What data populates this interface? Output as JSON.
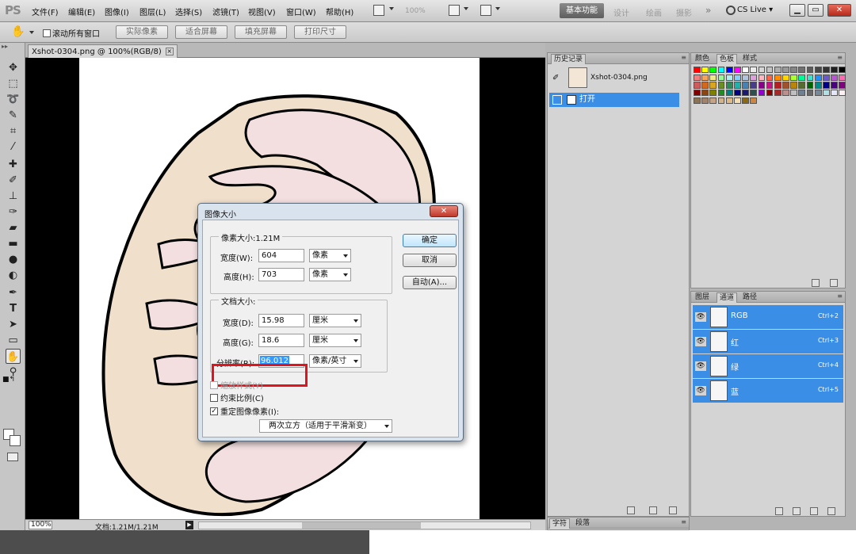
{
  "app": {
    "logo": "PS"
  },
  "menu": [
    "文件(F)",
    "编辑(E)",
    "图像(I)",
    "图层(L)",
    "选择(S)",
    "滤镜(T)",
    "视图(V)",
    "窗口(W)",
    "帮助(H)"
  ],
  "zoom_dropdown": "100%",
  "workspaces": {
    "active": "基本功能",
    "items": [
      "设计",
      "绘画",
      "摄影"
    ],
    "more": "»"
  },
  "cs_live": "CS Live ▾",
  "window_controls": {
    "minimize": "▁",
    "restore": "▭",
    "close": "✕"
  },
  "options_bar": {
    "scroll_all_windows": "滚动所有窗口",
    "buttons": [
      "实际像素",
      "适合屏幕",
      "填充屏幕",
      "打印尺寸"
    ]
  },
  "tools": [
    "move",
    "marquee",
    "lasso",
    "quick-select",
    "crop",
    "eyedropper",
    "healing",
    "brush",
    "stamp",
    "history-brush",
    "eraser",
    "gradient",
    "blur",
    "dodge",
    "pen",
    "type",
    "path-select",
    "shape",
    "hand",
    "zoom"
  ],
  "document": {
    "tab_title": "Xshot-0304.png @ 100%(RGB/8)",
    "tab_close": "×",
    "status_zoom": "100%",
    "status_doc": "文档:1.21M/1.21M",
    "status_arrow": "▶"
  },
  "history_panel": {
    "tabs": [
      "历史记录"
    ],
    "snapshot": "Xshot-0304.png",
    "states": [
      "打开"
    ]
  },
  "swatches_panel": {
    "tabs": [
      "颜色",
      "色板",
      "样式"
    ],
    "colors": [
      "#ff0000",
      "#ffff00",
      "#00ff00",
      "#00ffff",
      "#0000ff",
      "#ff00ff",
      "#ffffff",
      "#ebebeb",
      "#d6d6d6",
      "#c2c2c2",
      "#adadad",
      "#999999",
      "#858585",
      "#707070",
      "#5c5c5c",
      "#474747",
      "#333333",
      "#1f1f1f",
      "#000000",
      "#f08080",
      "#f4a460",
      "#f0e68c",
      "#98fb98",
      "#afeeee",
      "#87cefa",
      "#b0c4de",
      "#dda0dd",
      "#ffb6c1",
      "#ff6347",
      "#ff8c00",
      "#ffd700",
      "#adff2f",
      "#00fa9a",
      "#40e0d0",
      "#1e90ff",
      "#6a5acd",
      "#ba55d3",
      "#ff69b4",
      "#cd5c5c",
      "#d2691e",
      "#daa520",
      "#6b8e23",
      "#2e8b57",
      "#20b2aa",
      "#4682b4",
      "#483d8b",
      "#8b008b",
      "#c71585",
      "#b22222",
      "#a0522d",
      "#b8860b",
      "#556b2f",
      "#006400",
      "#008b8b",
      "#00008b",
      "#4b0082",
      "#800080",
      "#800000",
      "#8b4513",
      "#808000",
      "#228b22",
      "#008080",
      "#000080",
      "#191970",
      "#2f4f4f",
      "#9400d3",
      "#8b0000",
      "#a52a2a",
      "#bc8f8f",
      "#c0c0c0",
      "#708090",
      "#696969",
      "#778899",
      "#b0e0e6",
      "#e6e6fa",
      "#fff0f5",
      "#8b7355",
      "#a0826d",
      "#c4a484",
      "#d2b48c",
      "#deb887",
      "#f5deb3",
      "#8b6914",
      "#cd853f"
    ]
  },
  "channels_panel": {
    "tabs": [
      "图层",
      "通道",
      "路径"
    ],
    "channels": [
      {
        "name": "RGB",
        "shortcut": "Ctrl+2"
      },
      {
        "name": "红",
        "shortcut": "Ctrl+3"
      },
      {
        "name": "绿",
        "shortcut": "Ctrl+4"
      },
      {
        "name": "蓝",
        "shortcut": "Ctrl+5"
      }
    ]
  },
  "bottom_panel": {
    "tabs": [
      "字符",
      "段落"
    ]
  },
  "dialog": {
    "title": "图像大小",
    "close": "✕",
    "pixel_dimensions": {
      "title": "像素大小:1.21M",
      "width_label": "宽度(W):",
      "width_value": "604",
      "width_unit": "像素",
      "height_label": "高度(H):",
      "height_value": "703",
      "height_unit": "像素"
    },
    "document_size": {
      "title": "文档大小:",
      "width_label": "宽度(D):",
      "width_value": "15.98",
      "width_unit": "厘米",
      "height_label": "高度(G):",
      "height_value": "18.6",
      "height_unit": "厘米",
      "resolution_label": "分辨率(R):",
      "resolution_value": "96.012",
      "resolution_unit": "像素/英寸"
    },
    "buttons": {
      "ok": "确定",
      "cancel": "取消",
      "auto": "自动(A)..."
    },
    "checkboxes": {
      "scale_styles": "缩放样式(Y)",
      "constrain": "约束比例(C)",
      "resample": "重定图像像素(I):"
    },
    "resample_method": "两次立方（适用于平滑渐变）"
  }
}
